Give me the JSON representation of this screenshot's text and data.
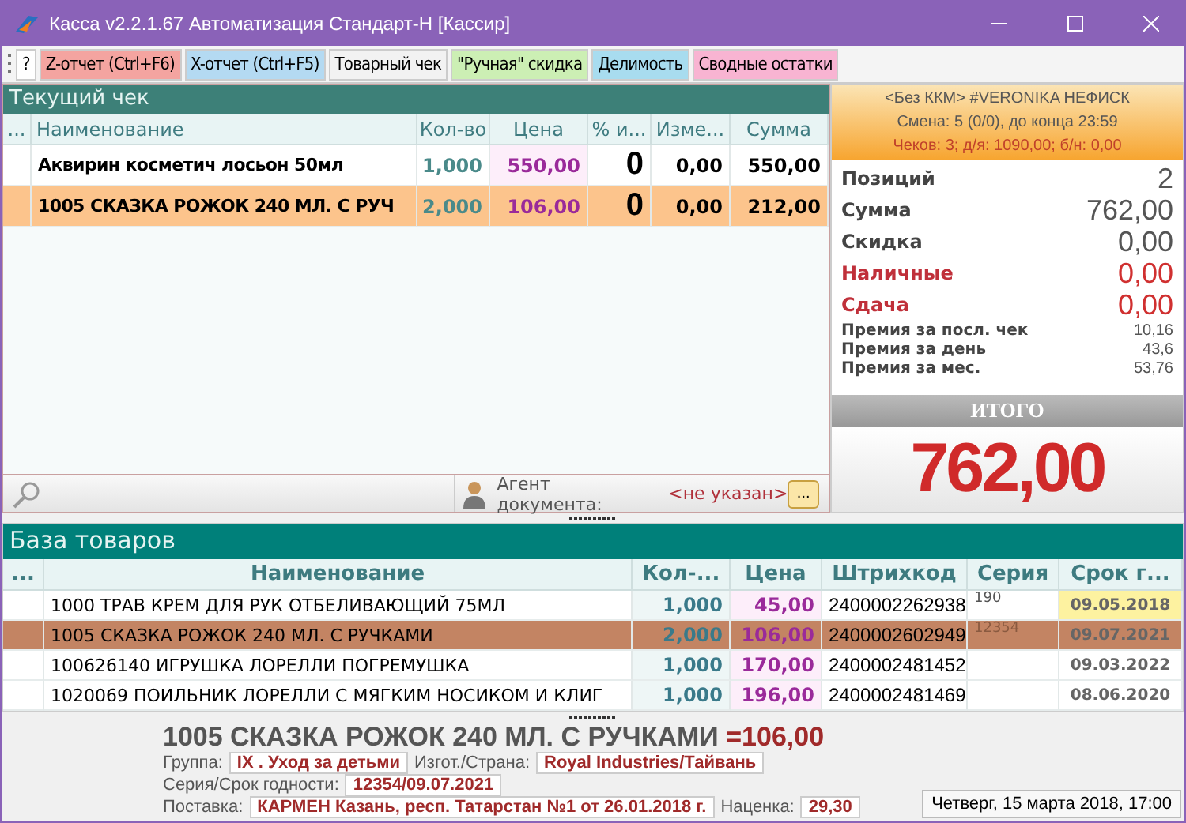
{
  "window": {
    "title": "Касса v2.2.1.67 Автоматизация Стандарт-Н [Кассир]"
  },
  "toolbar": {
    "help": "?",
    "buttons": [
      {
        "label": "Z-отчет (Ctrl+F6)",
        "color": "#f4a4a0"
      },
      {
        "label": "X-отчет (Ctrl+F5)",
        "color": "#b4daf2"
      },
      {
        "label": "Товарный чек",
        "color": "#f2f2f2"
      },
      {
        "label": "\"Ручная\" скидка",
        "color": "#ccefb4"
      },
      {
        "label": "Делимость",
        "color": "#a8dcef"
      },
      {
        "label": "Сводные остатки",
        "color": "#f8b4d2"
      }
    ]
  },
  "receipt": {
    "title": "Текущий чек",
    "columns": [
      "...",
      "Наименование",
      "Кол-во",
      "Цена",
      "% и...",
      "Изме...",
      "Сумма"
    ],
    "rows": [
      {
        "name": "Аквирин косметич лосьон 50мл",
        "qty": "1,000",
        "price": "550,00",
        "discount": "0",
        "change": "0,00",
        "sum": "550,00",
        "selected": false
      },
      {
        "name": "1005 СКАЗКА РОЖОК 240 МЛ. С РУЧ",
        "qty": "2,000",
        "price": "106,00",
        "discount": "0",
        "change": "0,00",
        "sum": "212,00",
        "selected": true
      }
    ],
    "agent_label": "Агент документа:",
    "agent_value": "<не указан>",
    "agent_button": "..."
  },
  "session": {
    "lines": [
      "<Без ККМ> #VERONIKA НЕФИСК",
      "Смена: 5 (0/0), до конца 23:59",
      "Чеков: 3; д/я: 1090,00; б/н: 0,00"
    ]
  },
  "summary": [
    {
      "kind": "main",
      "label": "Позиций",
      "value": "2"
    },
    {
      "kind": "main",
      "label": "Сумма",
      "value": "762,00"
    },
    {
      "kind": "main",
      "label": "Скидка",
      "value": "0,00"
    },
    {
      "kind": "alert",
      "label": "Наличные",
      "value": "0,00"
    },
    {
      "kind": "alert",
      "label": "Сдача",
      "value": "0,00"
    },
    {
      "kind": "bonus",
      "label": "Премия за посл. чек",
      "value": "10,16"
    },
    {
      "kind": "bonus",
      "label": "Премия за день",
      "value": "43,6"
    },
    {
      "kind": "bonus",
      "label": "Премия за мес.",
      "value": "53,76"
    }
  ],
  "total": {
    "label": "ИТОГО",
    "value": "762,00"
  },
  "catalog": {
    "title": "База товаров",
    "columns": [
      "...",
      "Наименование",
      "Кол-...",
      "Цена",
      "Штрихкод",
      "Серия",
      "Срок г..."
    ],
    "rows": [
      {
        "name": "1000 ТРАВ КРЕМ ДЛЯ РУК ОТБЕЛИВАЮЩИЙ 75МЛ",
        "qty": "1,000",
        "price": "45,00",
        "barcode": "2400002262938",
        "series": "190",
        "expiry": "09.05.2018",
        "expiry_flag": true,
        "selected": false
      },
      {
        "name": "1005 СКАЗКА РОЖОК 240 МЛ. С РУЧКАМИ",
        "qty": "2,000",
        "price": "106,00",
        "barcode": "2400002602949",
        "series": "12354",
        "expiry": "09.07.2021",
        "expiry_flag": false,
        "selected": true
      },
      {
        "name": "100626140 ИГРУШКА ЛОРЕЛЛИ ПОГРЕМУШКА",
        "qty": "1,000",
        "price": "170,00",
        "barcode": "2400002481452",
        "series": "",
        "expiry": "09.03.2022",
        "expiry_flag": false,
        "selected": false
      },
      {
        "name": "1020069 ПОИЛЬНИК ЛОРЕЛЛИ С МЯГКИМ НОСИКОМ И КЛИГ",
        "qty": "1,000",
        "price": "196,00",
        "barcode": "2400002481469",
        "series": "",
        "expiry": "08.06.2020",
        "expiry_flag": false,
        "selected": false
      }
    ]
  },
  "details": {
    "product": "1005 СКАЗКА РОЖОК 240 МЛ. С РУЧКАМИ",
    "price": "=106,00",
    "lines": [
      [
        {
          "label": "Группа:",
          "value": "IX . Уход за детьми"
        },
        {
          "label": "Изгот./Страна:",
          "value": "Royal Industries/Тайвань"
        }
      ],
      [
        {
          "label": "Серия/Срок годности:",
          "value": "12354/09.07.2021"
        }
      ],
      [
        {
          "label": "Поставка:",
          "value": "КАРМЕН Казань, респ. Татарстан №1 от 26.01.2018 г."
        },
        {
          "label": "Наценка:",
          "value": "29,30"
        }
      ]
    ]
  },
  "status": {
    "datetime": "Четверг, 15 марта 2018, 17:00"
  }
}
